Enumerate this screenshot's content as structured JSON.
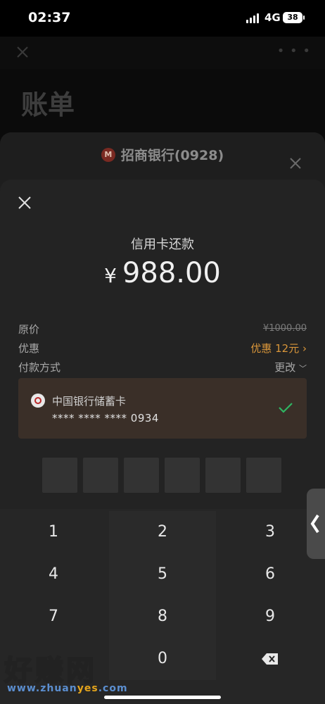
{
  "status_bar": {
    "time": "02:37",
    "network": "4G",
    "battery": "38"
  },
  "background": {
    "title": "账单"
  },
  "bank_sheet": {
    "bank_name": "招商银行(0928)",
    "logo_text": "M"
  },
  "payment": {
    "title": "信用卡还款",
    "currency": "¥",
    "amount": "988.00",
    "original_label": "原价",
    "original_value": "¥1000.00",
    "discount_label": "优惠",
    "discount_value": "优惠 12元",
    "method_label": "付款方式",
    "change_label": "更改",
    "card": {
      "name": "中国银行储蓄卡",
      "number": "**** **** **** 0934",
      "selected": true
    },
    "pin_boxes": 6
  },
  "keypad": {
    "keys": [
      "1",
      "2",
      "3",
      "4",
      "5",
      "6",
      "7",
      "8",
      "9",
      "",
      "0",
      "delete"
    ]
  },
  "watermark": {
    "text": "好赚网",
    "url_prefix": "www.zhuan",
    "url_highlight": "yes",
    "url_suffix": ".com"
  },
  "colors": {
    "accent_discount": "#d9963a",
    "check_green": "#2fb562",
    "card_bg": "#3a2f28"
  }
}
